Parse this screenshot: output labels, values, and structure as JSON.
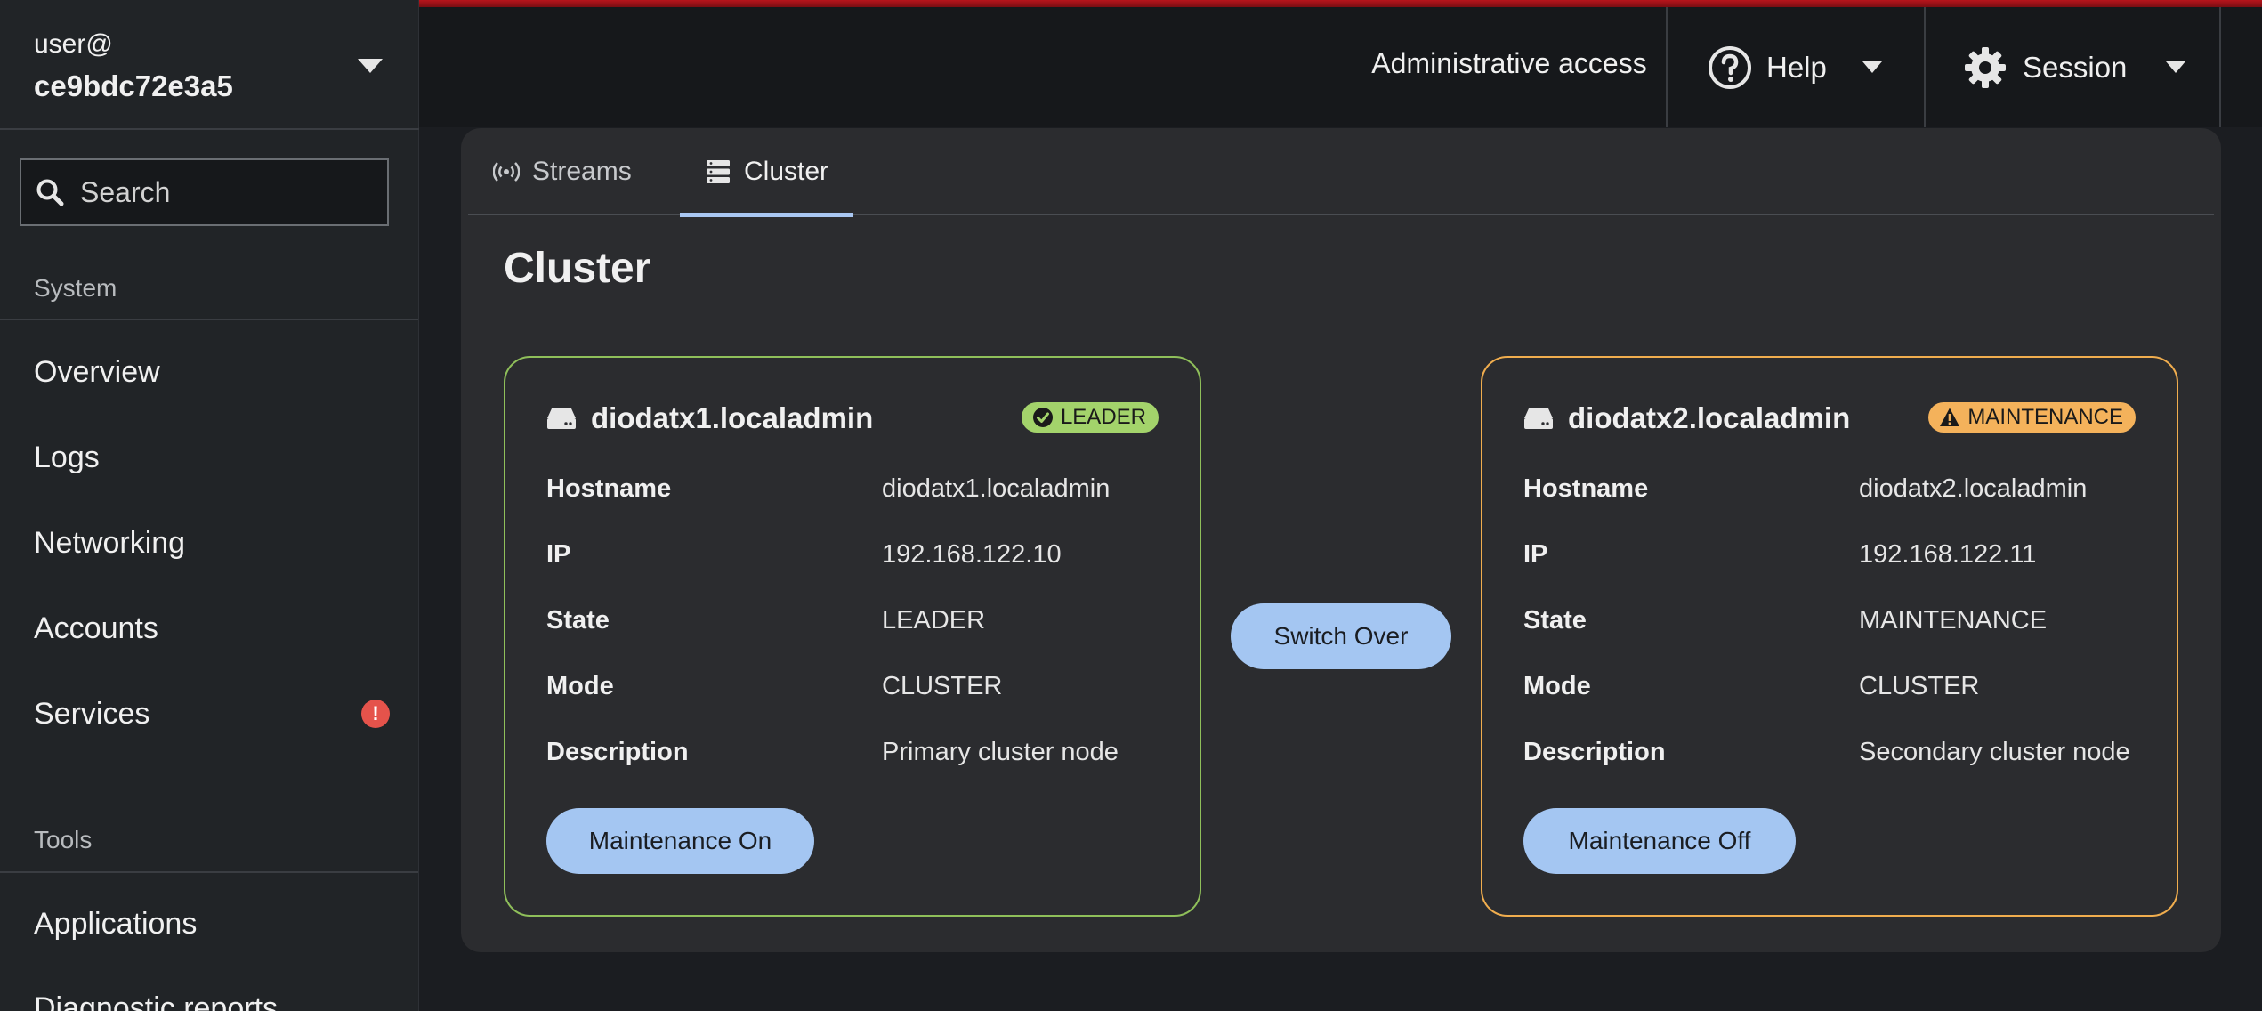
{
  "host": {
    "user": "user@",
    "name": "ce9bdc72e3a5"
  },
  "search": {
    "placeholder": "Search"
  },
  "sidebar": {
    "system_title": "System",
    "system_items": [
      {
        "label": "Overview"
      },
      {
        "label": "Logs"
      },
      {
        "label": "Networking"
      },
      {
        "label": "Accounts"
      },
      {
        "label": "Services",
        "alert": "!"
      }
    ],
    "tools_title": "Tools",
    "tools_items": [
      {
        "label": "Applications"
      },
      {
        "label": "Diagnostic reports"
      }
    ]
  },
  "topbar": {
    "admin_access": "Administrative access",
    "help_label": "Help",
    "session_label": "Session"
  },
  "tabs": [
    {
      "label": "Streams",
      "icon": "broadcast-icon",
      "active": false
    },
    {
      "label": "Cluster",
      "icon": "server-rack-icon",
      "active": true
    }
  ],
  "page": {
    "title": "Cluster"
  },
  "nodes": [
    {
      "title": "diodatx1.localadmin",
      "badge": "LEADER",
      "badge_icon": "check-circle-icon",
      "border_color": "#8fbf5a",
      "rows": [
        {
          "key": "Hostname",
          "value": "diodatx1.localadmin"
        },
        {
          "key": "IP",
          "value": "192.168.122.10"
        },
        {
          "key": "State",
          "value": "LEADER"
        },
        {
          "key": "Mode",
          "value": "CLUSTER"
        },
        {
          "key": "Description",
          "value": "Primary cluster node"
        }
      ],
      "button": "Maintenance On"
    },
    {
      "title": "diodatx2.localadmin",
      "badge": "MAINTENANCE",
      "badge_icon": "warning-triangle-icon",
      "border_color": "#f0ad4e",
      "rows": [
        {
          "key": "Hostname",
          "value": "diodatx2.localadmin"
        },
        {
          "key": "IP",
          "value": "192.168.122.11"
        },
        {
          "key": "State",
          "value": "MAINTENANCE"
        },
        {
          "key": "Mode",
          "value": "CLUSTER"
        },
        {
          "key": "Description",
          "value": "Secondary cluster node"
        }
      ],
      "button": "Maintenance Off"
    }
  ],
  "actions": {
    "switch_over": "Switch Over"
  },
  "colors": {
    "accent_bar": "#b8141c",
    "button_bg": "#a4c6f2",
    "leader_green": "#a3d36b",
    "maintenance_orange": "#f4b25b",
    "alert_red": "#e5534b"
  }
}
